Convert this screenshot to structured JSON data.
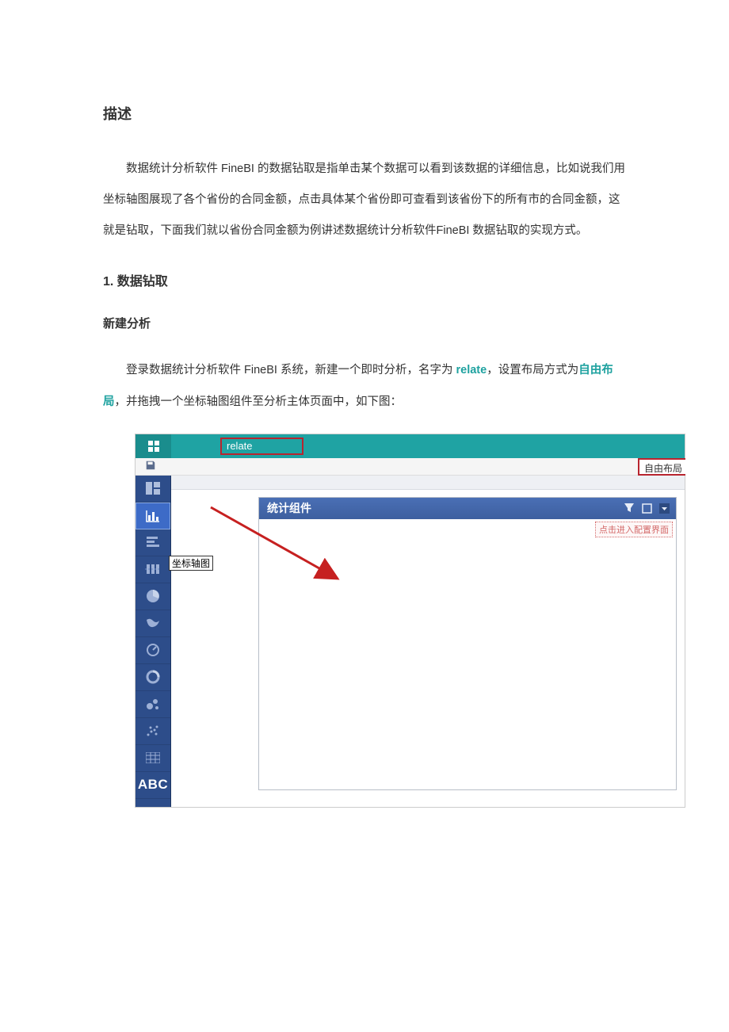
{
  "doc": {
    "h1": "描述",
    "p1": "数据统计分析软件 FineBI 的数据钻取是指单击某个数据可以看到该数据的详细信息，比如说我们用坐标轴图展现了各个省份的合同金额，点击具体某个省份即可查看到该省份下的所有市的合同金额，这就是钻取，下面我们就以省份合同金额为例讲述数据统计分析软件FineBI 数据钻取的实现方式。",
    "h2": "1. 数据钻取",
    "h3": "新建分析",
    "p2_a": "登录数据统计分析软件 FineBI 系统，新建一个即时分析，名字为 ",
    "p2_link": "relate",
    "p2_b": "，设置布局方式为",
    "p2_bold": "自由布局",
    "p2_c": "，并拖拽一个坐标轴图组件至分析主体页面中，如下图："
  },
  "screenshot": {
    "tab_name": "relate",
    "layout_label": "自由布局",
    "tooltip": "坐标轴图",
    "widget_title": "统计组件",
    "config_hint": "点击进入配置界面",
    "sidebar_abc": "ABC"
  }
}
